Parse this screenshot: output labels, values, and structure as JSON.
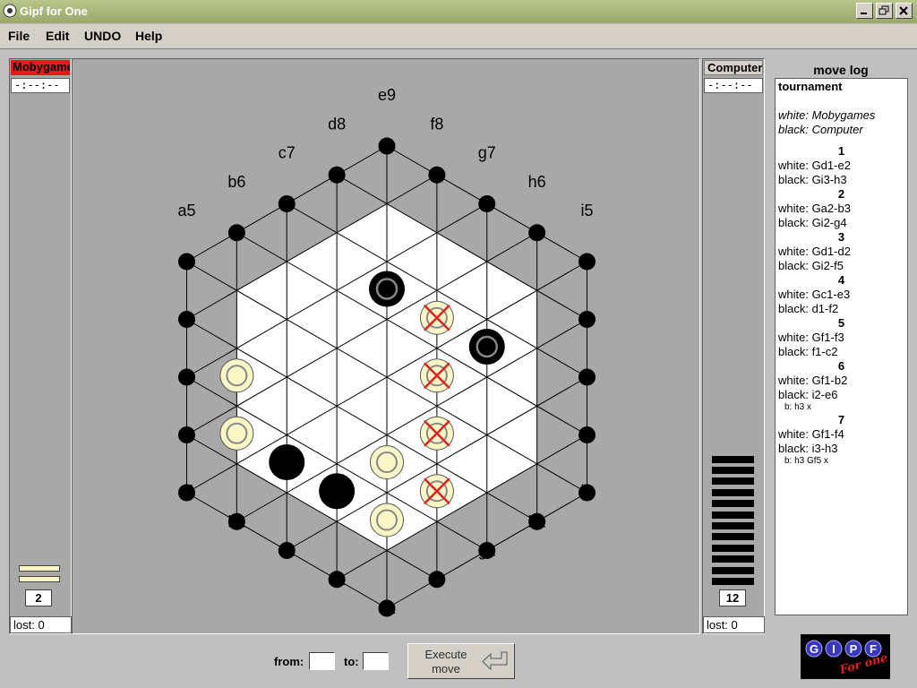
{
  "window": {
    "title": "Gipf for One"
  },
  "menu": [
    "File",
    "Edit",
    "UNDO",
    "Help"
  ],
  "left_player": {
    "name": "Mobygames",
    "timer": "-:--:--",
    "reserve_count": "2",
    "lost": "lost: 0"
  },
  "right_player": {
    "name": "Computer",
    "timer": "-:--:--",
    "reserve_count": "12",
    "lost": "lost: 0"
  },
  "board": {
    "top_labels": [
      "a5",
      "b6",
      "c7",
      "d8",
      "e9",
      "f8",
      "g7",
      "h6",
      "i5"
    ],
    "bottom_labels": [
      "a1",
      "b1",
      "c1",
      "d1",
      "e1",
      "f1",
      "g1",
      "h1",
      "i1"
    ],
    "white_pieces": [
      "b2",
      "b3",
      "e2",
      "e3",
      "f2",
      "f3",
      "f4",
      "f5"
    ],
    "black_pieces": [
      "c2",
      "d2",
      "e6",
      "g4"
    ],
    "marked_pieces": [
      "f2",
      "f3",
      "f4",
      "f5"
    ],
    "gipf_pieces": [
      "e6",
      "g4"
    ],
    "colors": {
      "white_piece": "#fbf6c6",
      "black_piece": "#000000",
      "mark": "#e02020",
      "board": "#ffffff"
    }
  },
  "movelog": {
    "title": "move log",
    "header": "tournament",
    "white_player": "white: Mobygames",
    "black_player": "black: Computer",
    "moves": [
      {
        "n": "1",
        "white": "white: Gd1-e2",
        "black": "black: Gi3-h3",
        "sub": ""
      },
      {
        "n": "2",
        "white": "white: Ga2-b3",
        "black": "black: Gi2-g4",
        "sub": ""
      },
      {
        "n": "3",
        "white": "white: Gd1-d2",
        "black": "black: Gi2-f5",
        "sub": ""
      },
      {
        "n": "4",
        "white": "white: Gc1-e3",
        "black": "black: d1-f2",
        "sub": ""
      },
      {
        "n": "5",
        "white": "white: Gf1-f3",
        "black": "black: f1-c2",
        "sub": ""
      },
      {
        "n": "6",
        "white": "white: Gf1-b2",
        "black": "black: i2-e6",
        "sub": "b: h3 x"
      },
      {
        "n": "7",
        "white": "white: Gf1-f4",
        "black": "black: i3-h3",
        "sub": "b: h3 Gf5 x"
      }
    ]
  },
  "controls": {
    "from_label": "from:",
    "to_label": "to:",
    "execute_label": "Execute move"
  },
  "logo": {
    "letters": [
      "G",
      "I",
      "P",
      "F"
    ],
    "script": "For one"
  }
}
